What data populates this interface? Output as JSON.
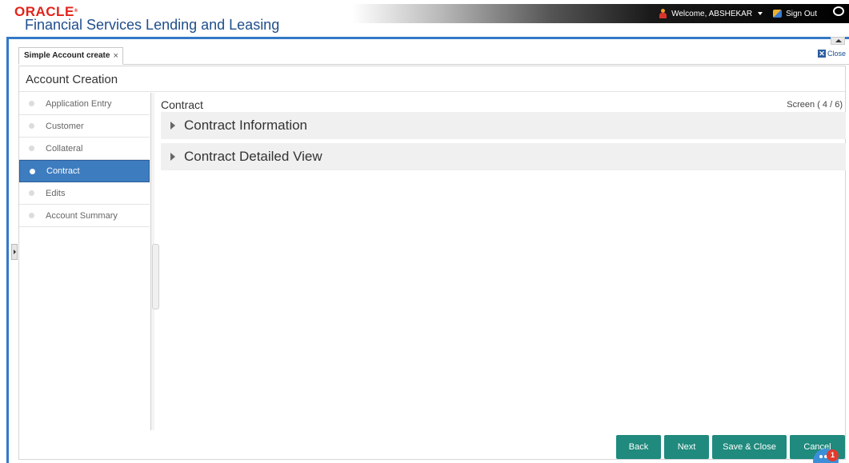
{
  "header": {
    "brand": "ORACLE",
    "app_title": "Financial Services Lending and Leasing",
    "welcome": "Welcome, ABSHEKAR",
    "sign_out": "Sign Out"
  },
  "tabs": [
    {
      "label": "Simple Account create",
      "close": "×"
    }
  ],
  "close_link": "Close",
  "page": {
    "title": "Account Creation",
    "train": [
      {
        "label": "Application Entry",
        "active": false
      },
      {
        "label": "Customer",
        "active": false
      },
      {
        "label": "Collateral",
        "active": false
      },
      {
        "label": "Contract",
        "active": true
      },
      {
        "label": "Edits",
        "active": false
      },
      {
        "label": "Account Summary",
        "active": false
      }
    ],
    "content_title": "Contract",
    "screen_counter": "Screen ( 4 / 6)",
    "sections": [
      {
        "label": "Contract Information"
      },
      {
        "label": "Contract Detailed View"
      }
    ]
  },
  "buttons": {
    "back": "Back",
    "next": "Next",
    "save_close": "Save & Close",
    "cancel": "Cancel"
  },
  "notification_count": "1",
  "colors": {
    "accent": "#3478c6",
    "active_step": "#3d7cbf",
    "button": "#1f8a7d",
    "brand_red": "#e2231a"
  }
}
